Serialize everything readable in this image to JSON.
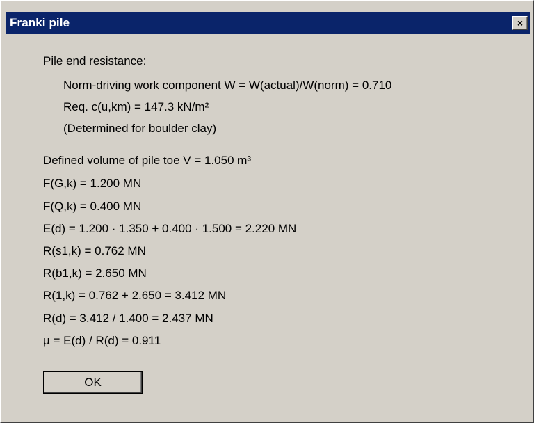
{
  "window": {
    "title": "Franki pile",
    "close_label": "×"
  },
  "content": {
    "lines": [
      "Pile end resistance:",
      "Norm-driving work component W  = W(actual)/W(norm) = 0.710",
      "Req. c(u,km) = 147.3 kN/m²",
      "(Determined for boulder clay)",
      "Defined volume of pile toe V = 1.050 m³",
      "F(G,k) = 1.200 MN",
      "F(Q,k) = 0.400 MN",
      "E(d) = 1.200 · 1.350 + 0.400 · 1.500 = 2.220 MN",
      "R(s1,k) = 0.762 MN",
      "R(b1,k) = 2.650 MN",
      "R(1,k) = 0.762 + 2.650 = 3.412 MN",
      "R(d) = 3.412 / 1.400 = 2.437 MN",
      "µ = E(d) / R(d) = 0.911"
    ]
  },
  "buttons": {
    "ok_label": "OK"
  },
  "colors": {
    "titlebar": "#0a246a",
    "dialog_bg": "#d4d0c8"
  }
}
